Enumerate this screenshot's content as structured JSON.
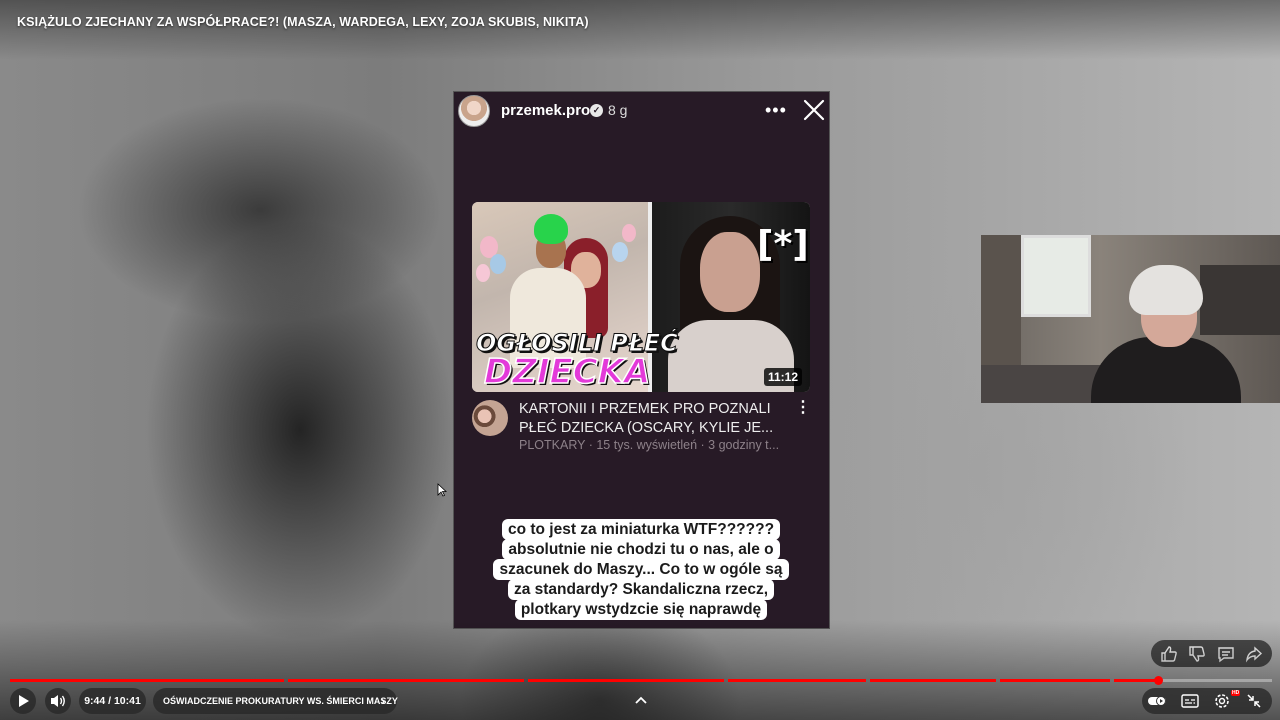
{
  "video": {
    "title": "KSIĄŻULO ZJECHANY ZA WSPÓŁPRACE?! (MASZA, WARDEGA, LEXY, ZOJA SKUBIS, NIKITA)",
    "current_time": "9:44 / 10:41",
    "chapter": "OŚWIADCZENIE PROKURATURY WS. ŚMIERCI MASZY",
    "progress_fraction": 0.91,
    "accent_color": "#ff0000"
  },
  "story": {
    "username": "przemek.pro",
    "time_ago": "8 g",
    "thumbnail": {
      "line1": "OGŁOSILI PŁEĆ",
      "line2": "DZIECKA",
      "censor": "[*]",
      "duration": "11:12"
    },
    "card": {
      "title": "KARTONII I PRZEMEK PRO POZNALI PŁEĆ DZIECKA (OSCARY, KYLIE JE...",
      "meta": "PLOTKARY · 15 tys. wyświetleń · 3 godziny t..."
    },
    "caption_lines": [
      "co to jest za miniaturka WTF??????",
      "absolutnie nie chodzi tu o nas, ale o",
      "szacunek do Maszy... Co to w ogóle są",
      "za standardy? Skandaliczna rzecz,",
      "plotkary wstydzcie się naprawdę"
    ]
  },
  "icons": {
    "close": "close-icon",
    "more": "more-icon",
    "like": "thumbs-up-icon",
    "dislike": "thumbs-down-icon",
    "comment": "comment-icon",
    "share": "share-icon",
    "play": "play-icon",
    "volume": "volume-icon",
    "expand": "chevron-up-icon",
    "autoplay": "autoplay-toggle-icon",
    "captions": "captions-icon",
    "settings": "settings-icon",
    "exit_fullscreen": "exit-fullscreen-icon"
  }
}
